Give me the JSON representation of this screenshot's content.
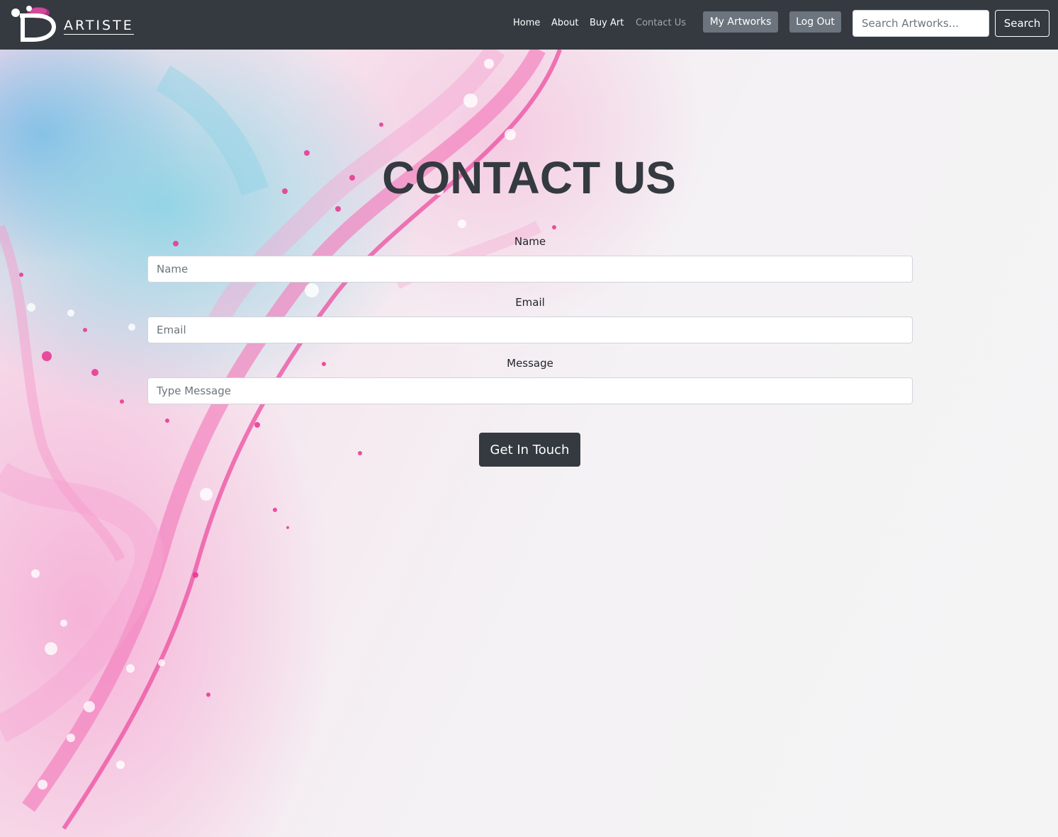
{
  "brand": {
    "logo_letter": "D",
    "name": "ARTISTE"
  },
  "nav": {
    "links": [
      {
        "label": "Home"
      },
      {
        "label": "About"
      },
      {
        "label": "Buy Art"
      },
      {
        "label": "Contact Us",
        "active": true
      }
    ],
    "my_artworks_label": "My Artworks",
    "logout_label": "Log Out",
    "search": {
      "placeholder": "Search Artworks...",
      "value": "",
      "button_label": "Search"
    }
  },
  "page": {
    "title": "CONTACT US"
  },
  "form": {
    "fields": [
      {
        "label": "Name",
        "placeholder": "Name",
        "value": ""
      },
      {
        "label": "Email",
        "placeholder": "Email",
        "value": ""
      },
      {
        "label": "Message",
        "placeholder": "Type Message",
        "value": ""
      }
    ],
    "submit_label": "Get In Touch"
  },
  "colors": {
    "navbar": "#343a40",
    "secondary_button": "#6c757d",
    "primary_text": "#343a40",
    "active_link": "#a3a7ab",
    "accent_pink": "#e9338f"
  }
}
